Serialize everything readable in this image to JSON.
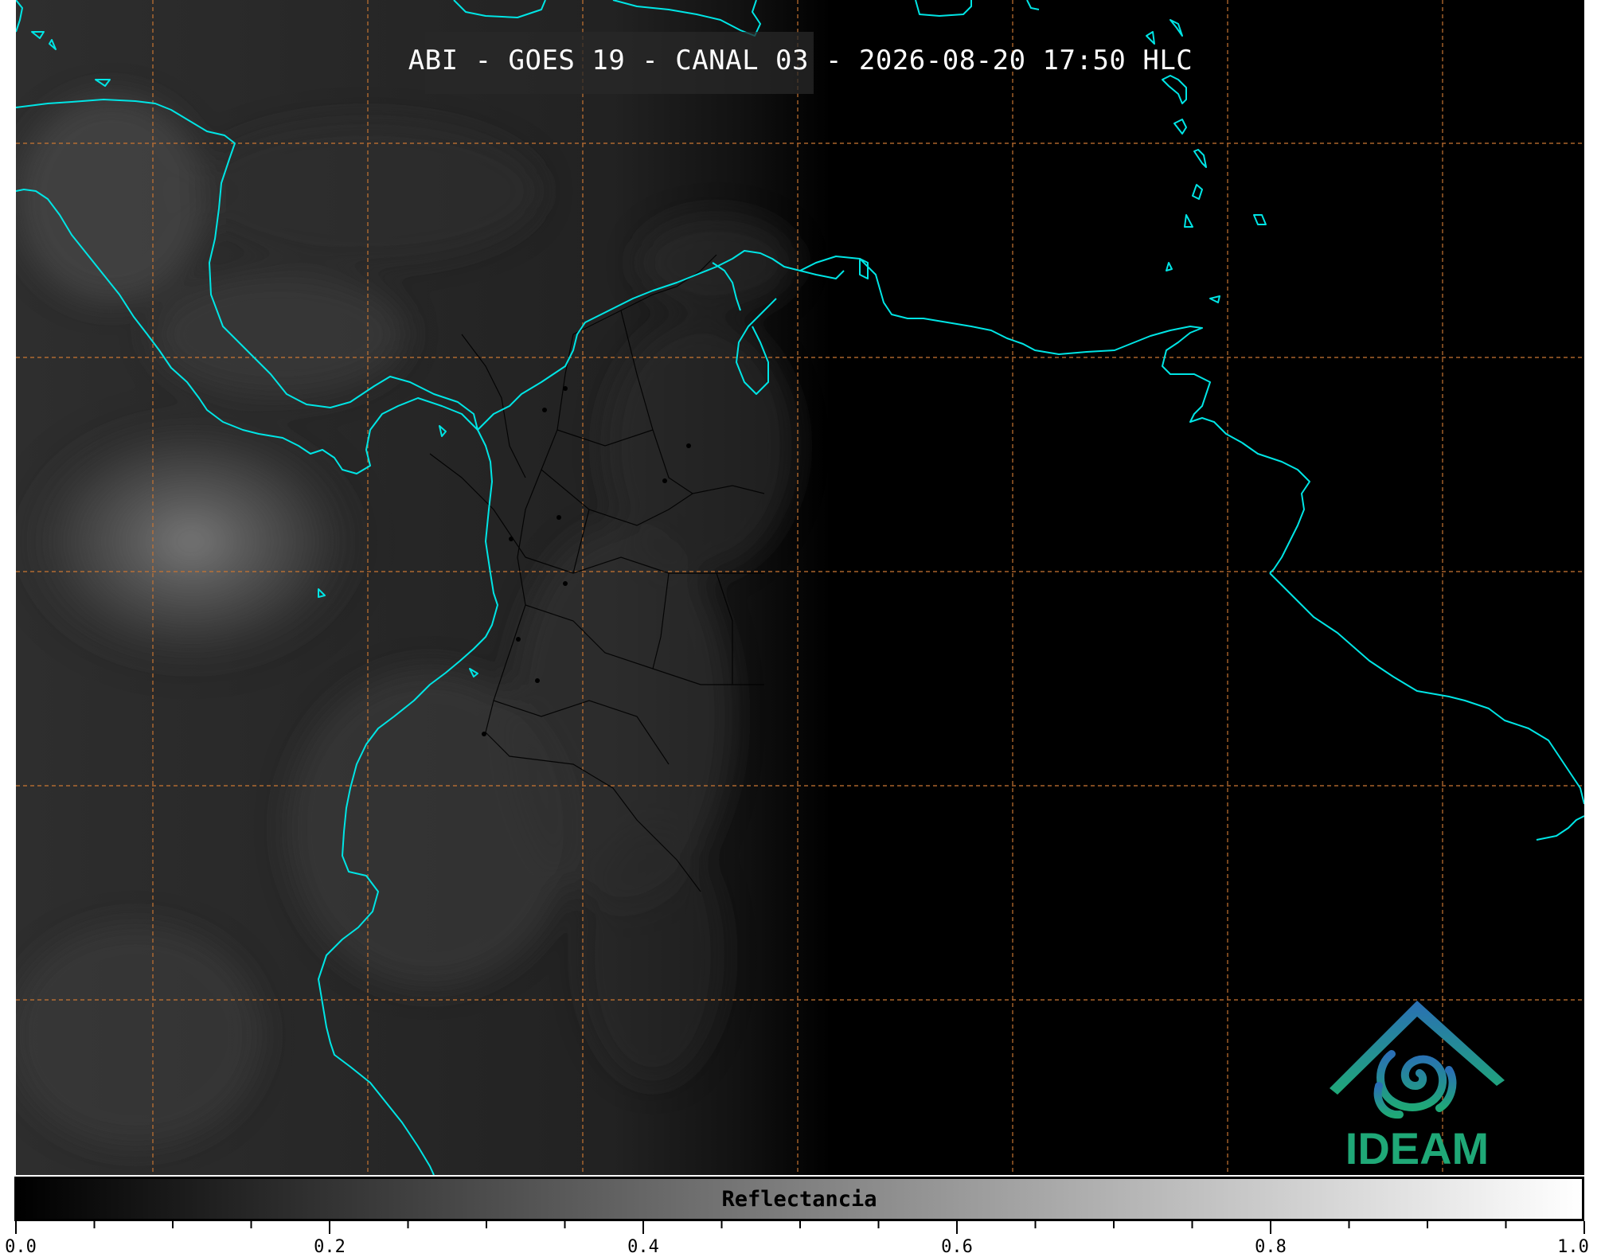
{
  "title": "ABI - GOES 19 - CANAL 03 - 2026-08-20 17:50 HLC",
  "logo_text": "IDEAM",
  "colorbar": {
    "label": "Reflectancia",
    "min": 0.0,
    "max": 1.0,
    "major_ticks": [
      "0.0",
      "0.2",
      "0.4",
      "0.6",
      "0.8",
      "1.0"
    ],
    "gradient": [
      "#000000",
      "#ffffff"
    ]
  },
  "colors": {
    "coastline": "#00e5e5",
    "gridlines": "#c87533",
    "borders": "#000000",
    "background": "#000000",
    "logo_blue": "#2a6fb5",
    "logo_green": "#1fa877"
  }
}
